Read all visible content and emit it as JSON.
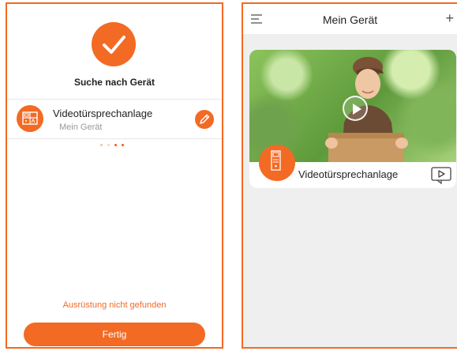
{
  "left_screen": {
    "title": "Suche nach Gerät",
    "device": {
      "name": "Videotürsprechanlage",
      "subtitle": "Mein Gerät"
    },
    "not_found_text": "Ausrüstung nicht gefunden",
    "done_button": "Fertig"
  },
  "right_screen": {
    "header_title": "Mein Gerät",
    "card": {
      "device_name": "Videotürsprechanlage"
    }
  },
  "colors": {
    "accent": "#f36a24",
    "panel_border": "#f26a22",
    "right_background": "#efefef"
  },
  "icons": {
    "check": "check-icon",
    "intercom": "intercom-icon",
    "edit": "pencil-icon",
    "menu": "menu-icon",
    "add": "plus-icon",
    "play": "play-icon",
    "video": "video-play-icon"
  }
}
